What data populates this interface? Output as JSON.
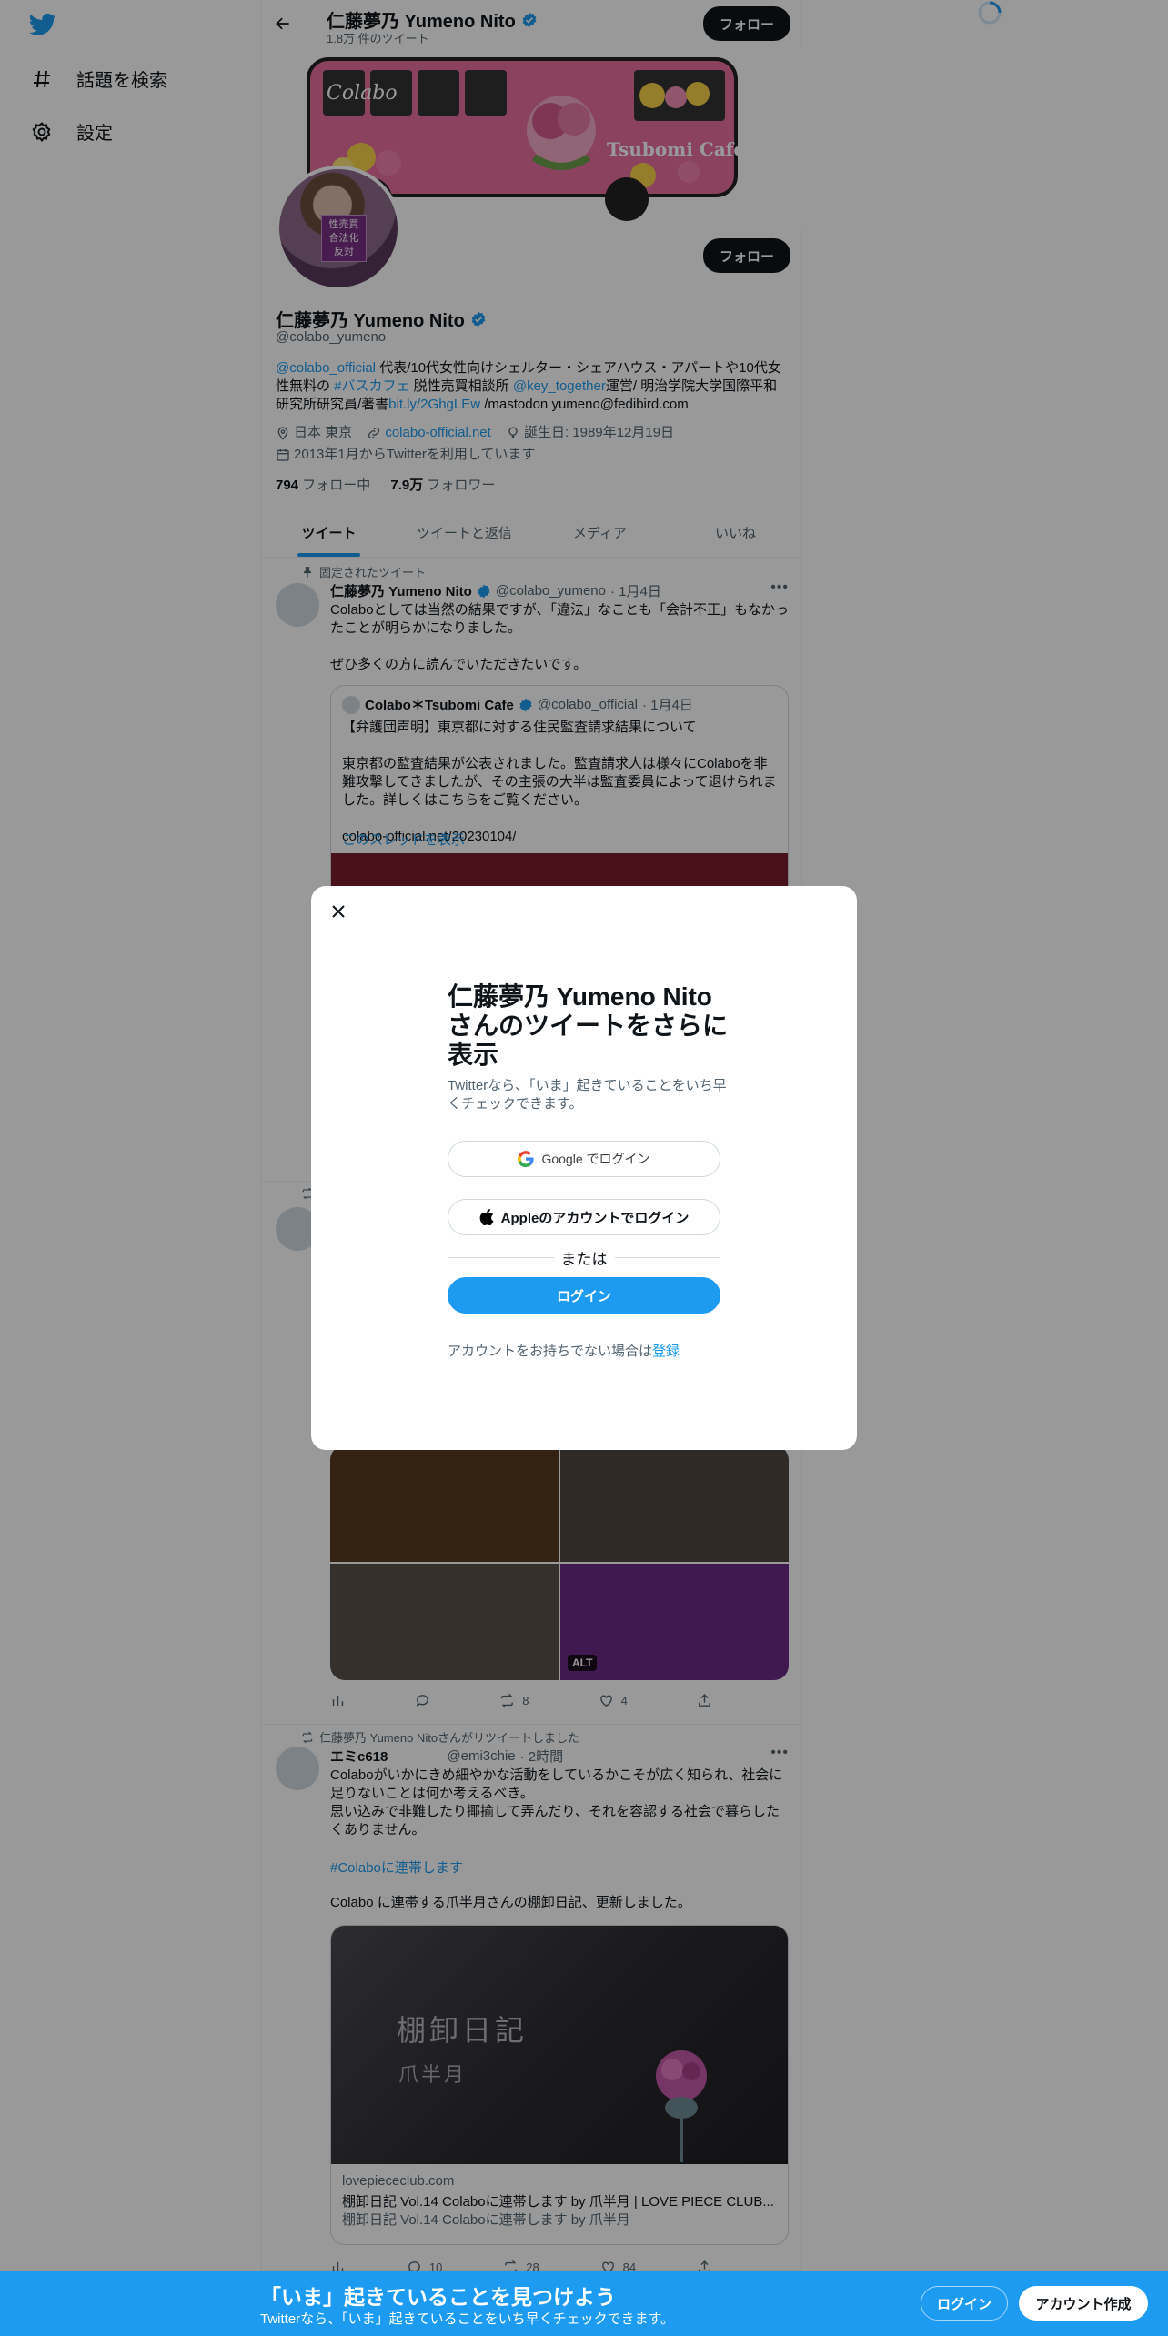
{
  "nav": {
    "explore_label": "話題を検索",
    "settings_label": "設定"
  },
  "topbar": {
    "name": "仁藤夢乃 Yumeno Nito",
    "tweet_count": "1.8万 件のツイート",
    "follow_label": "フォロー"
  },
  "banner": {
    "bus_logo": "Colabo",
    "bus_text": "Tsubomi Cafe"
  },
  "avatar": {
    "sign_text": "性売買\n合法化\n反対"
  },
  "profile": {
    "follow_label": "フォロー",
    "name": "仁藤夢乃 Yumeno Nito",
    "handle": "@colabo_yumeno",
    "bio": {
      "mention1": "@colabo_official",
      "text1": " 代表/10代女性向けシェルター・シェアハウス・アパートや10代女性無料の ",
      "hashtag": "#バスカフェ",
      "text2": " 脱性売買相談所 ",
      "mention2": "@key_together",
      "text3": "運営/ 明治学院大学国際平和研究所研究員/著書",
      "link": "bit.ly/2GhgLEw",
      "text4": " /mastodon yumeno@fedibird.com"
    },
    "location": "日本 東京",
    "url": "colabo-official.net",
    "birthday": "誕生日: 1989年12月19日",
    "joined": "2013年1月からTwitterを利用しています",
    "following_count": "794",
    "following_label": " フォロー中",
    "followers_count": "7.9万",
    "followers_label": " フォロワー"
  },
  "tabs": [
    "ツイート",
    "ツイートと返信",
    "メディア",
    "いいね"
  ],
  "pinned_tweet": {
    "context": "固定されたツイート",
    "name": "仁藤夢乃 Yumeno Nito",
    "handle": "@colabo_yumeno",
    "date": "· 1月4日",
    "text": "Colaboとしては当然の結果ですが、「違法」なことも「会計不正」もなかったことが明らかになりました。\n\nぜひ多くの方に読んでいただきたいです。",
    "quote": {
      "name": "Colabo＊Tsubomi Cafe",
      "handle": "@colabo_official",
      "date": "· 1月4日",
      "text": "【弁護団声明】東京都に対する住民監査請求結果について\n\n東京都の監査結果が公表されました。監査請求人は様々にColaboを非難攻撃してきましたが、その主張の大半は監査委員によって退けられました。詳しくはこちらをご覧ください。\n\ncolabo-official.net/20230104/",
      "thread_link": "このスレッドを表示"
    }
  },
  "tweet2": {
    "alt_badge": "ALT",
    "replies": "",
    "retweets": "8",
    "likes": "4"
  },
  "tweet3": {
    "context": "仁藤夢乃 Yumeno Nitoさんがリツイートしました",
    "name": "エミc618",
    "handle": "@emi3chie",
    "date": "· 2時間",
    "text": "Colaboがいかにきめ細やかな活動をしているかこそが広く知られ、社会に足りないことは何か考えるべき。\n思い込みで非難したり揶揄して弄んだり、それを容認する社会で暮らしたくありません。",
    "hashtag": "#Colaboに連帯します",
    "text2": "Colabo に連帯する爪半月さんの棚卸日記、更新しました。",
    "card_image_title": "棚卸日記",
    "card_image_author": "爪半月",
    "card_domain": "lovepiececlub.com",
    "card_title": "棚卸日記 Vol.14 Colaboに連帯します by 爪半月 | LOVE PIECE CLUB...",
    "card_desc": "棚卸日記 Vol.14 Colaboに連帯します by 爪半月",
    "replies": "10",
    "retweets": "28",
    "likes": "84"
  },
  "modal": {
    "title": "仁藤夢乃 Yumeno Nitoさんのツイートをさらに表示",
    "subtitle": "Twitterなら、「いま」起きていることをいち早くチェックできます。",
    "google_label": "Google でログイン",
    "apple_label": "Appleのアカウントでログイン",
    "or_label": "または",
    "login_label": "ログイン",
    "signup_prompt": "アカウントをお持ちでない場合は",
    "signup_link": "登録"
  },
  "bottombar": {
    "title": "「いま」起きていることを見つけよう",
    "subtitle": "Twitterなら、「いま」起きていることをいち早くチェックできます。",
    "login_label": "ログイン",
    "signup_label": "アカウント作成"
  },
  "colors": {
    "accent": "#1d9bf0",
    "bus_pink": "#e66f9e",
    "dark": "#0f1419"
  }
}
